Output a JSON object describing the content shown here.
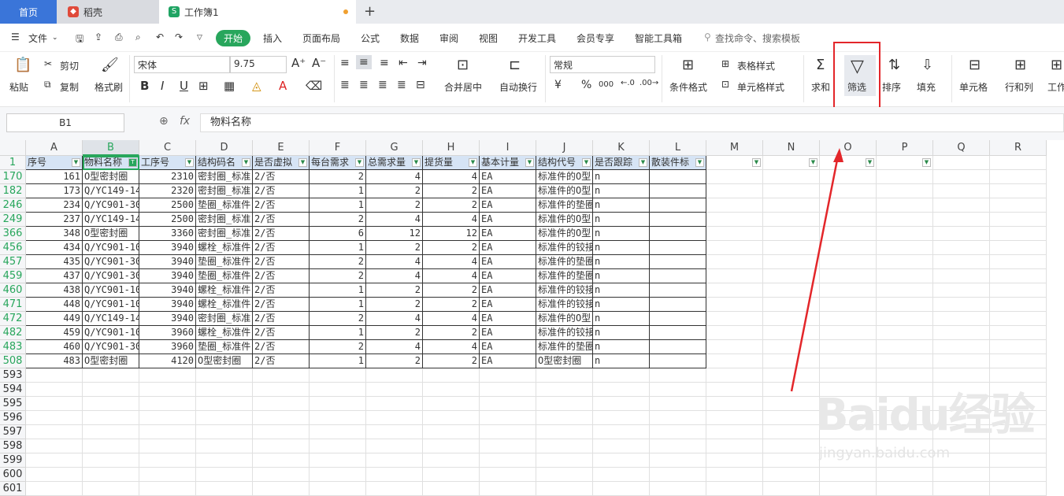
{
  "tabs": {
    "home": "首页",
    "daoke": "稻壳",
    "workbook": "工作簿1",
    "new_tab": "+"
  },
  "menu": {
    "file": "文件",
    "start": "开始",
    "insert": "插入",
    "page_layout": "页面布局",
    "formula": "公式",
    "data": "数据",
    "review": "审阅",
    "view": "视图",
    "dev_tools": "开发工具",
    "member": "会员专享",
    "smart_toolbox": "智能工具箱",
    "search": "查找命令、搜索模板"
  },
  "ribbon": {
    "paste": "粘贴",
    "cut": "剪切",
    "copy": "复制",
    "format_painter": "格式刷",
    "font_name": "宋体",
    "font_size": "9.75",
    "bold": "B",
    "italic": "I",
    "underline": "U",
    "merge_center": "合并居中",
    "wrap": "自动换行",
    "number_format": "常规",
    "currency": "¥",
    "percent": "%",
    "thousands": "000",
    "cond_format": "条件格式",
    "table_style": "表格样式",
    "cell_style": "单元格样式",
    "sum": "求和",
    "filter": "筛选",
    "sort": "排序",
    "fill": "填充",
    "cell": "单元格",
    "row_col": "行和列",
    "worksheet": "工作"
  },
  "formula_bar": {
    "name_box": "B1",
    "fx": "fx",
    "content": "物料名称"
  },
  "columns": [
    "A",
    "B",
    "C",
    "D",
    "E",
    "F",
    "G",
    "H",
    "I",
    "J",
    "K",
    "L",
    "M",
    "N",
    "O",
    "P",
    "Q",
    "R"
  ],
  "header_row": {
    "row_num": "1",
    "cells": [
      "序号",
      "物料名称",
      "工序号",
      "结构码名",
      "是否虚拟",
      "每台需求",
      "总需求量",
      "提货量",
      "基本计量",
      "结构代号",
      "是否跟踪",
      "散装件标"
    ]
  },
  "rows": [
    {
      "n": "170",
      "c": [
        "161",
        "O型密封圈",
        "2310",
        "密封圈_标准",
        "2/否",
        "2",
        "4",
        "4",
        "EA",
        "标准件的O型",
        "n",
        ""
      ]
    },
    {
      "n": "182",
      "c": [
        "173",
        "Q/YC149-14",
        "2320",
        "密封圈_标准",
        "2/否",
        "1",
        "2",
        "2",
        "EA",
        "标准件的O型",
        "n",
        ""
      ]
    },
    {
      "n": "246",
      "c": [
        "234",
        "Q/YC901-30",
        "2500",
        "垫圈_标准件",
        "2/否",
        "1",
        "2",
        "2",
        "EA",
        "标准件的垫圈",
        "n",
        ""
      ]
    },
    {
      "n": "249",
      "c": [
        "237",
        "Q/YC149-14",
        "2500",
        "密封圈_标准",
        "2/否",
        "2",
        "4",
        "4",
        "EA",
        "标准件的O型",
        "n",
        ""
      ]
    },
    {
      "n": "366",
      "c": [
        "348",
        "O型密封圈",
        "3360",
        "密封圈_标准",
        "2/否",
        "6",
        "12",
        "12",
        "EA",
        "标准件的O型",
        "n",
        ""
      ]
    },
    {
      "n": "456",
      "c": [
        "434",
        "Q/YC901-10",
        "3940",
        "螺栓_标准件",
        "2/否",
        "1",
        "2",
        "2",
        "EA",
        "标准件的铰接",
        "n",
        ""
      ]
    },
    {
      "n": "457",
      "c": [
        "435",
        "Q/YC901-30",
        "3940",
        "垫圈_标准件",
        "2/否",
        "2",
        "4",
        "4",
        "EA",
        "标准件的垫圈",
        "n",
        ""
      ]
    },
    {
      "n": "459",
      "c": [
        "437",
        "Q/YC901-30",
        "3940",
        "垫圈_标准件",
        "2/否",
        "2",
        "4",
        "4",
        "EA",
        "标准件的垫圈",
        "n",
        ""
      ]
    },
    {
      "n": "460",
      "c": [
        "438",
        "Q/YC901-10",
        "3940",
        "螺栓_标准件",
        "2/否",
        "1",
        "2",
        "2",
        "EA",
        "标准件的铰接",
        "n",
        ""
      ]
    },
    {
      "n": "471",
      "c": [
        "448",
        "Q/YC901-10",
        "3940",
        "螺栓_标准件",
        "2/否",
        "1",
        "2",
        "2",
        "EA",
        "标准件的铰接",
        "n",
        ""
      ]
    },
    {
      "n": "472",
      "c": [
        "449",
        "Q/YC149-14",
        "3940",
        "密封圈_标准",
        "2/否",
        "2",
        "4",
        "4",
        "EA",
        "标准件的O型",
        "n",
        ""
      ]
    },
    {
      "n": "482",
      "c": [
        "459",
        "Q/YC901-10",
        "3960",
        "螺栓_标准件",
        "2/否",
        "1",
        "2",
        "2",
        "EA",
        "标准件的铰接",
        "n",
        ""
      ]
    },
    {
      "n": "483",
      "c": [
        "460",
        "Q/YC901-30",
        "3960",
        "垫圈_标准件",
        "2/否",
        "2",
        "4",
        "4",
        "EA",
        "标准件的垫圈",
        "n",
        ""
      ]
    },
    {
      "n": "508",
      "c": [
        "483",
        "O型密封圈",
        "4120",
        "O型密封圈",
        "2/否",
        "1",
        "2",
        "2",
        "EA",
        "O型密封圈",
        "n",
        ""
      ]
    }
  ],
  "empty_rows": [
    "593",
    "594",
    "595",
    "596",
    "597",
    "598",
    "599",
    "600",
    "601"
  ],
  "watermark": {
    "logo": "Baidu经验",
    "url": "jingyan.baidu.com"
  },
  "colors": {
    "accent": "#28a65c",
    "tab_blue": "#3a75d9",
    "highlight": "#e3262a",
    "header_fill": "#d6e4f5"
  }
}
